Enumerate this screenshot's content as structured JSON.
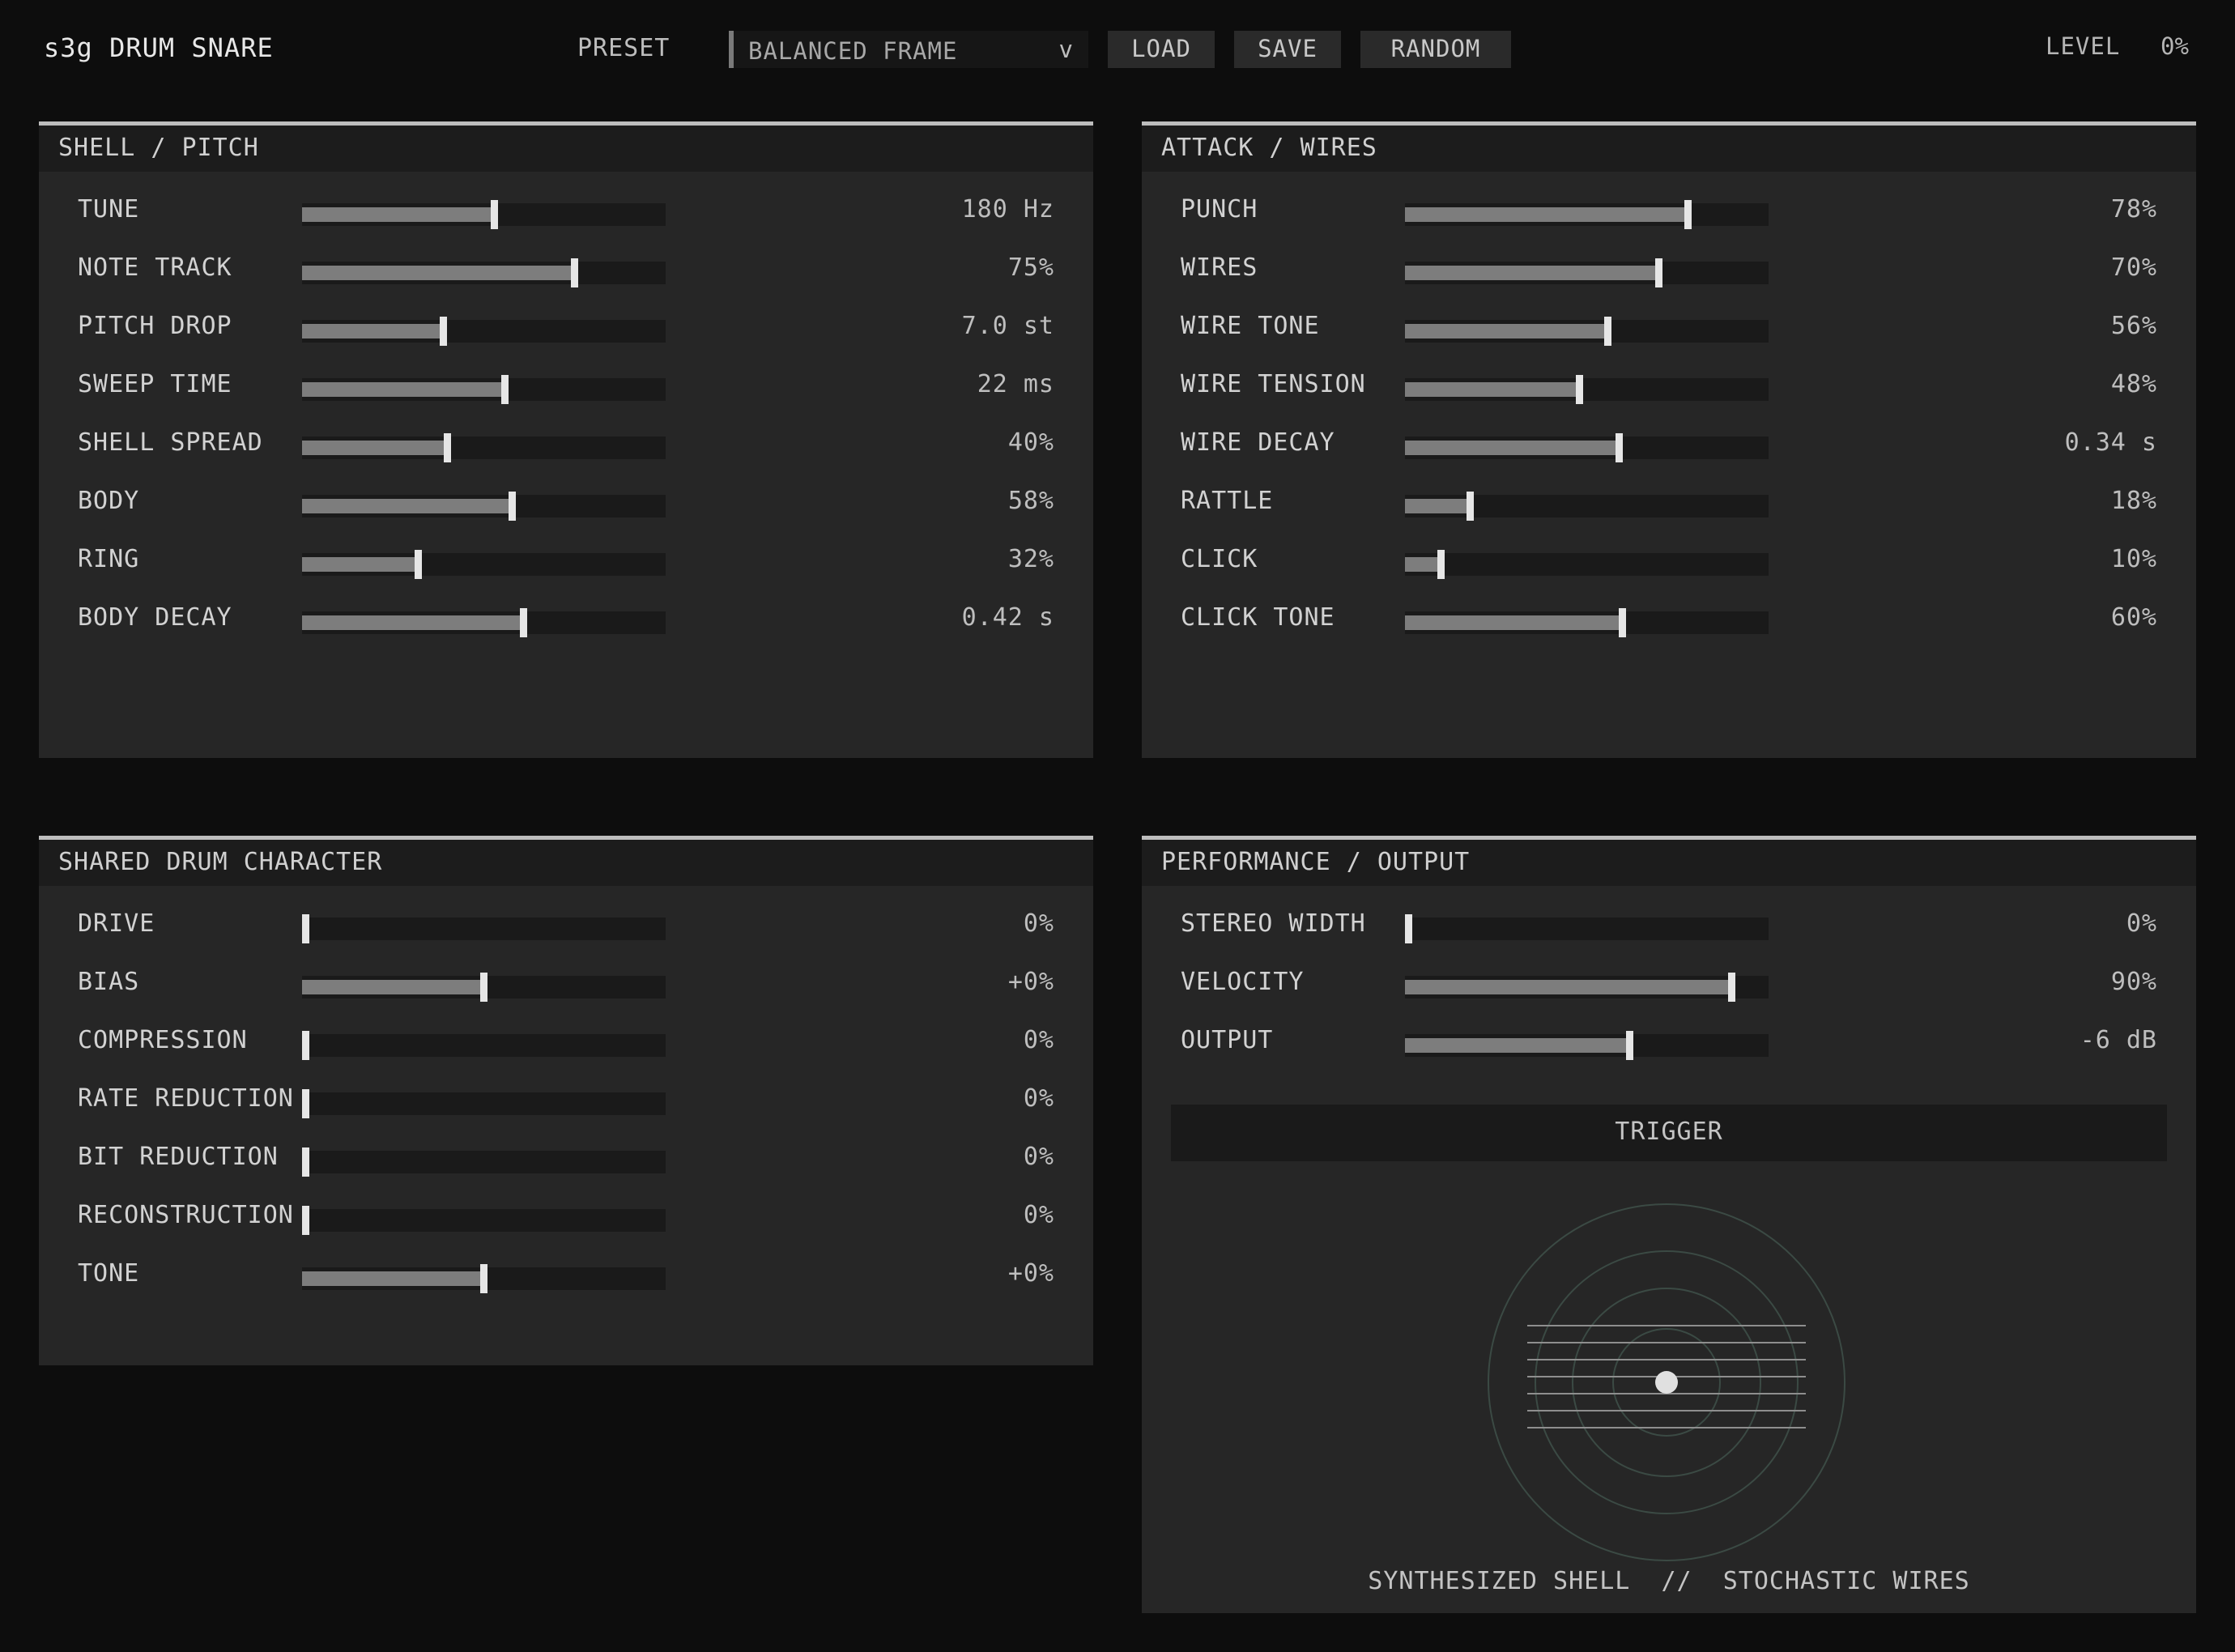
{
  "app": {
    "title": "s3g DRUM SNARE"
  },
  "toolbar": {
    "preset_label": "PRESET",
    "preset_value": "BALANCED FRAME",
    "preset_chevron": "v",
    "load_label": "LOAD",
    "save_label": "SAVE",
    "random_label": "RANDOM",
    "level_label": "LEVEL",
    "level_value": "0%"
  },
  "panels": {
    "shell": {
      "title": "SHELL / PITCH",
      "params": [
        {
          "label": "TUNE",
          "value": "180 Hz",
          "level": 0.53
        },
        {
          "label": "NOTE TRACK",
          "value": "75%",
          "level": 0.75
        },
        {
          "label": "PITCH DROP",
          "value": "7.0 st",
          "level": 0.39
        },
        {
          "label": "SWEEP TIME",
          "value": "22 ms",
          "level": 0.56
        },
        {
          "label": "SHELL SPREAD",
          "value": "40%",
          "level": 0.4
        },
        {
          "label": "BODY",
          "value": "58%",
          "level": 0.58
        },
        {
          "label": "RING",
          "value": "32%",
          "level": 0.32
        },
        {
          "label": "BODY DECAY",
          "value": "0.42 s",
          "level": 0.61
        }
      ]
    },
    "attack": {
      "title": "ATTACK / WIRES",
      "params": [
        {
          "label": "PUNCH",
          "value": "78%",
          "level": 0.78
        },
        {
          "label": "WIRES",
          "value": "70%",
          "level": 0.7
        },
        {
          "label": "WIRE TONE",
          "value": "56%",
          "level": 0.56
        },
        {
          "label": "WIRE TENSION",
          "value": "48%",
          "level": 0.48
        },
        {
          "label": "WIRE DECAY",
          "value": "0.34 s",
          "level": 0.59
        },
        {
          "label": "RATTLE",
          "value": "18%",
          "level": 0.18
        },
        {
          "label": "CLICK",
          "value": "10%",
          "level": 0.1
        },
        {
          "label": "CLICK TONE",
          "value": "60%",
          "level": 0.6
        }
      ]
    },
    "character": {
      "title": "SHARED DRUM CHARACTER",
      "params": [
        {
          "label": "DRIVE",
          "value": "0%",
          "level": 0.0
        },
        {
          "label": "BIAS",
          "value": "+0%",
          "level": 0.5
        },
        {
          "label": "COMPRESSION",
          "value": "0%",
          "level": 0.0
        },
        {
          "label": "RATE REDUCTION",
          "value": "0%",
          "level": 0.0
        },
        {
          "label": "BIT REDUCTION",
          "value": "0%",
          "level": 0.0
        },
        {
          "label": "RECONSTRUCTION",
          "value": "0%",
          "level": 0.0
        },
        {
          "label": "TONE",
          "value": "+0%",
          "level": 0.5
        }
      ]
    },
    "performance": {
      "title": "PERFORMANCE / OUTPUT",
      "params": [
        {
          "label": "STEREO WIDTH",
          "value": "0%",
          "level": 0.0
        },
        {
          "label": "VELOCITY",
          "value": "90%",
          "level": 0.9
        },
        {
          "label": "OUTPUT",
          "value": "-6 dB",
          "level": 0.62
        }
      ],
      "trigger_label": "TRIGGER",
      "caption": "SYNTHESIZED SHELL  //  STOCHASTIC WIRES"
    }
  },
  "colors": {
    "background": "#0d0d0d",
    "panel": "#262626",
    "slider_fill": "#7d7d7d",
    "slider_thumb": "#e6e6e6",
    "viz_rings": "#3b4a44"
  }
}
